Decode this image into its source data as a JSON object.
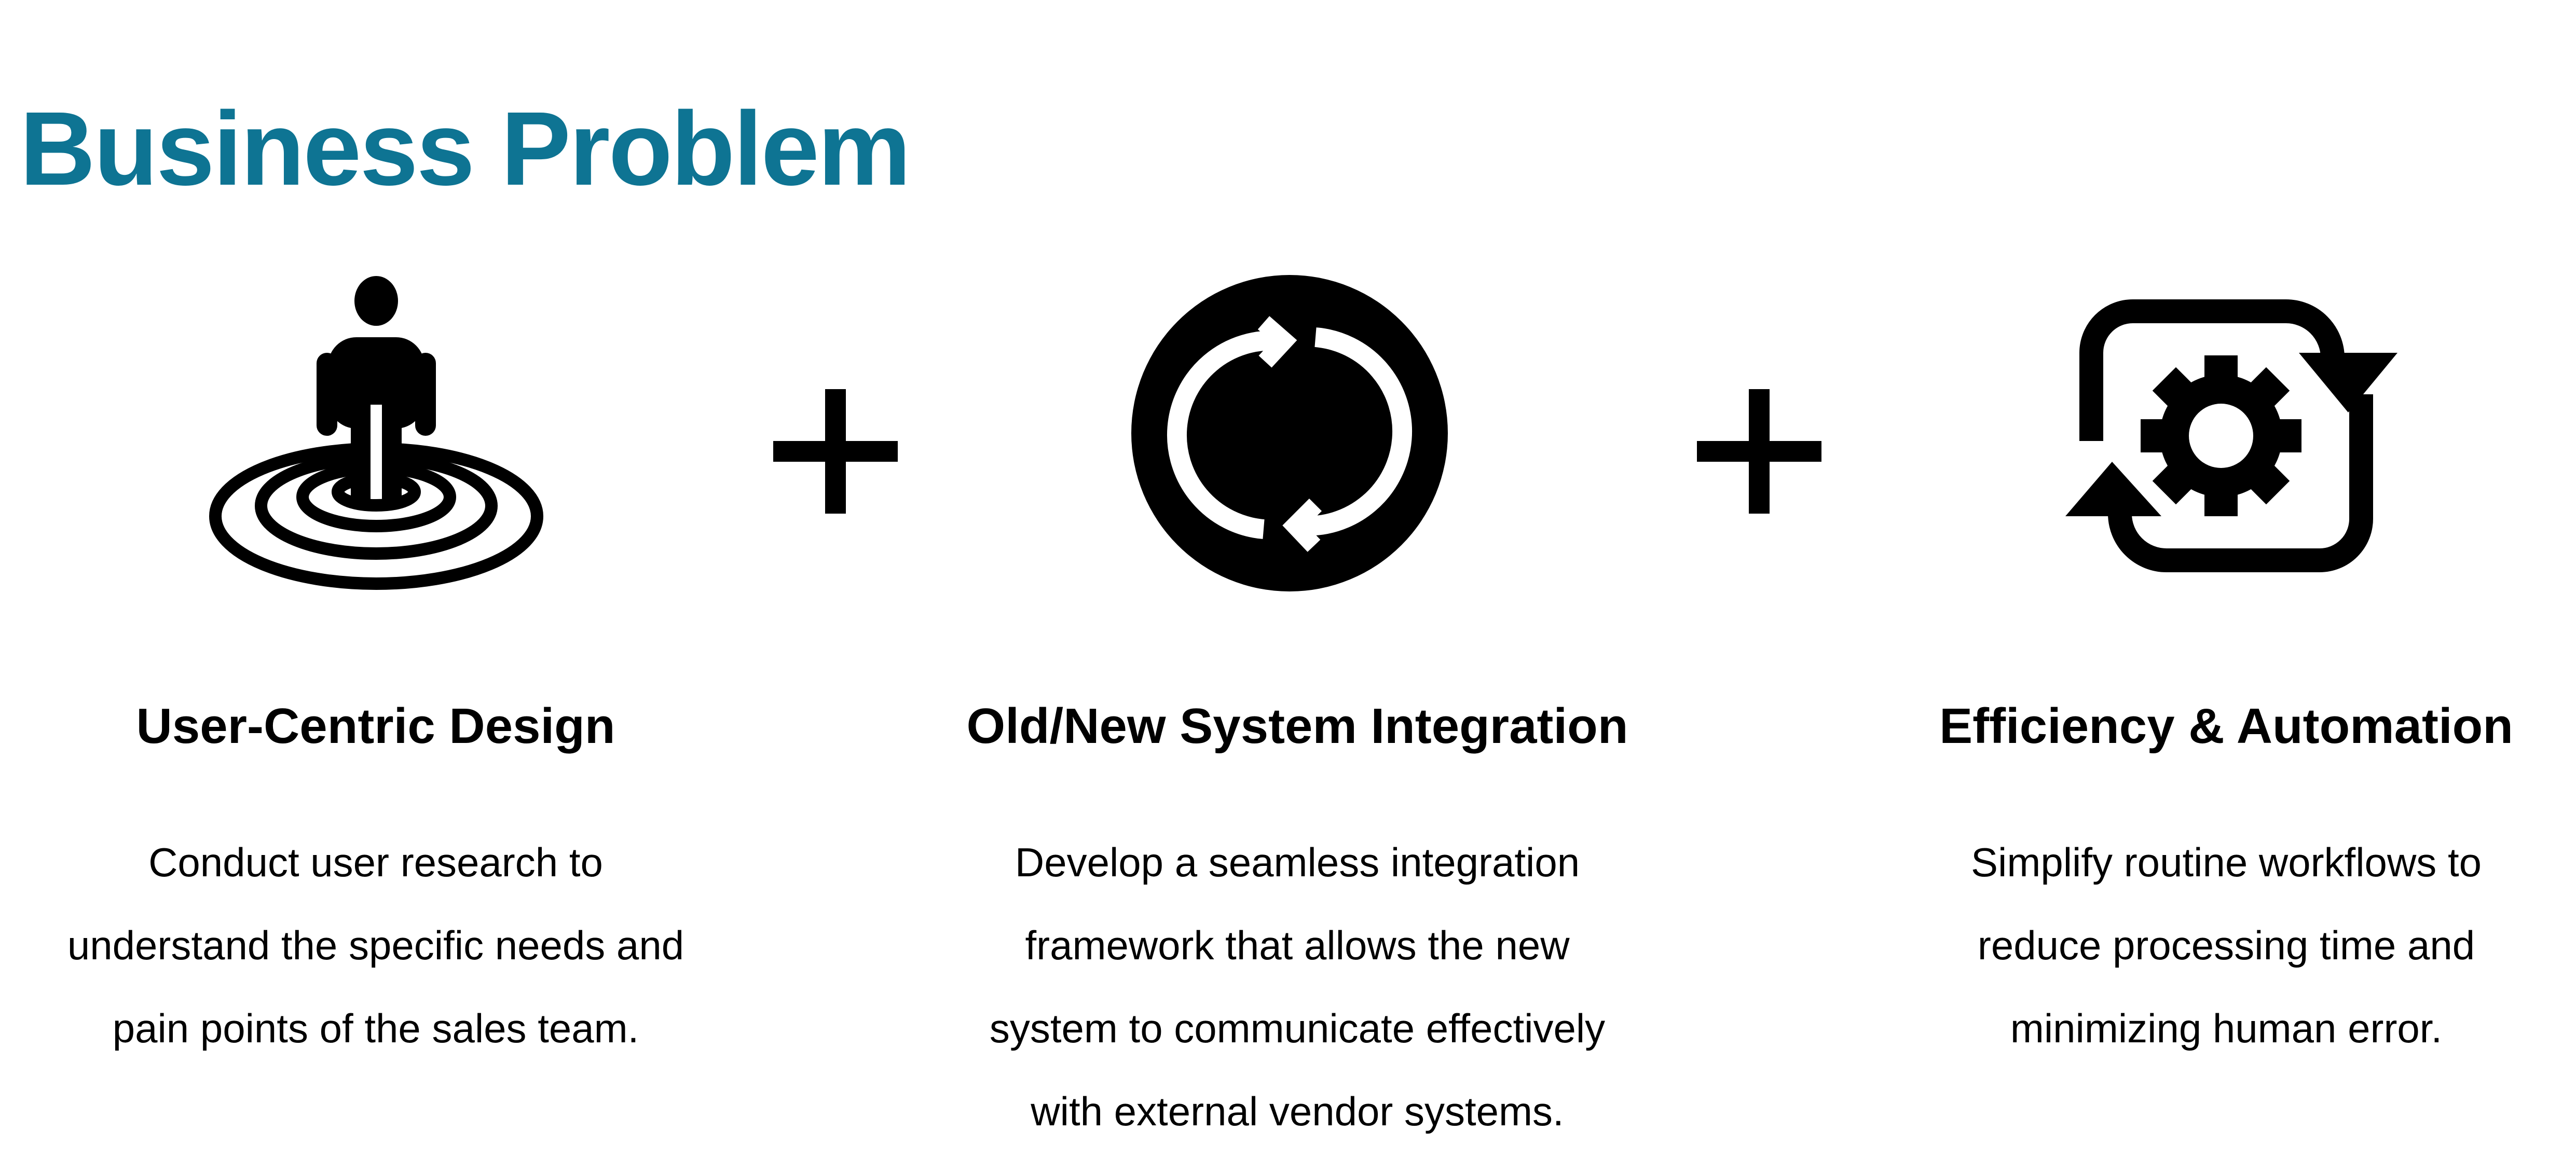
{
  "page": {
    "title": "Business Problem",
    "title_color": "#0e7493",
    "text_color": "#000000",
    "background": "#ffffff"
  },
  "icons": {
    "column_1": "person-on-target-icon",
    "column_2": "refresh-cycle-icon",
    "column_3": "gear-automation-icon",
    "separator": "plus-icon"
  },
  "columns": [
    {
      "heading": "User-Centric Design",
      "lines": [
        "Conduct user research to",
        "understand the specific needs and",
        "pain points of the sales team."
      ]
    },
    {
      "heading": "Old/New System Integration",
      "lines": [
        "Develop a seamless integration",
        "framework that allows the new",
        "system to communicate effectively",
        "with external vendor systems."
      ]
    },
    {
      "heading": "Efficiency & Automation",
      "lines": [
        "Simplify routine workflows to",
        "reduce processing time and",
        "minimizing human error."
      ]
    }
  ]
}
